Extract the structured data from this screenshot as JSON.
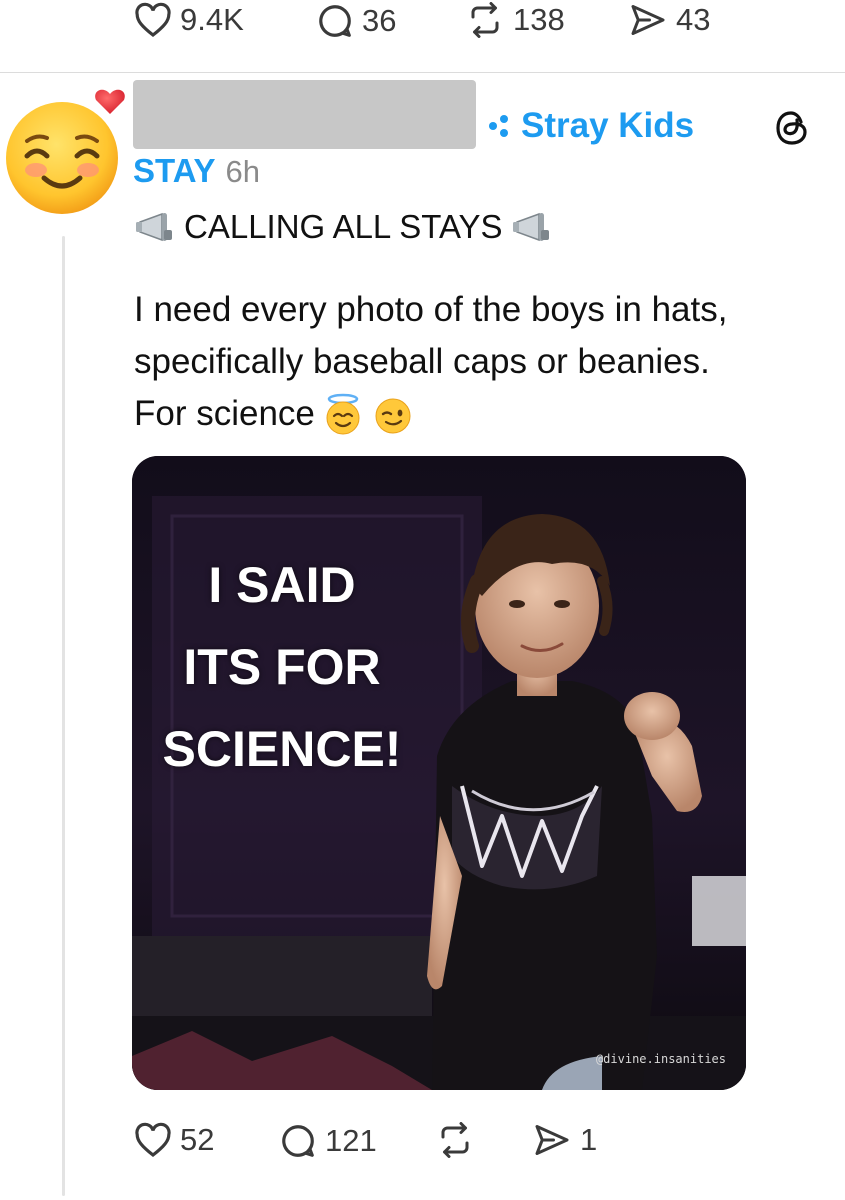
{
  "top_stats": {
    "likes": "9.4K",
    "replies": "36",
    "reposts": "138",
    "shares": "43"
  },
  "post": {
    "community": "Stray Kids",
    "handle": "STAY",
    "time": "6h",
    "headline": "CALLING ALL STAYS",
    "body_lines": [
      "I need every photo of the boys in hats,",
      "specifically baseball caps or beanies.",
      "For science"
    ],
    "media": {
      "caption_lines": [
        "I SAID",
        "ITS FOR",
        "SCIENCE!"
      ],
      "watermark": "@divine.insanities"
    },
    "stats": {
      "likes": "52",
      "replies": "121",
      "reposts": "",
      "shares": "1"
    }
  },
  "colors": {
    "accent": "#1d9bf0",
    "muted": "#8a8a8a",
    "icon": "#3a3a3a"
  },
  "icons": {
    "like": "heart-icon",
    "reply": "reply-bubble-icon",
    "repost": "repost-arrows-icon",
    "share": "send-icon",
    "threads": "threads-logo-icon",
    "megaphone": "megaphone-icon",
    "community": "community-dots-icon"
  }
}
